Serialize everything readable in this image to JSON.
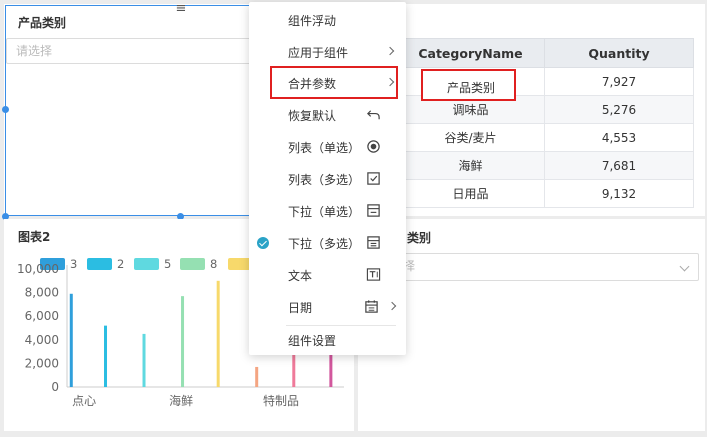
{
  "filter_panel": {
    "title": "产品类别",
    "placeholder": "请选择"
  },
  "table": {
    "columns": [
      "CategoryName",
      "Quantity"
    ],
    "rows": [
      [
        "",
        "7,927"
      ],
      [
        "调味品",
        "5,276"
      ],
      [
        "谷类/麦片",
        "4,553"
      ],
      [
        "海鲜",
        "7,681"
      ],
      [
        "日用品",
        "9,132"
      ]
    ]
  },
  "tooltip": {
    "text": "产品类别"
  },
  "chart": {
    "title": "图表2",
    "legend": [
      {
        "label": "3",
        "color": "#2f9fdb"
      },
      {
        "label": "2",
        "color": "#2bbde2"
      },
      {
        "label": "5",
        "color": "#5fd9e0"
      },
      {
        "label": "8",
        "color": "#95e0b2"
      },
      {
        "label": "",
        "color": "#f7d96b"
      }
    ]
  },
  "chart_data": {
    "type": "bar",
    "title": "图表2",
    "categories": [
      "点心",
      "海鲜",
      "特制品"
    ],
    "ylim": [
      0,
      10000
    ],
    "yticks": [
      "0",
      "2,000",
      "4,000",
      "6,000",
      "8,000",
      "10,000"
    ],
    "grid": false,
    "legend_position": "top-left",
    "series": [
      {
        "name": "3",
        "color": "#2f9fdb"
      },
      {
        "name": "2",
        "color": "#2bbde2"
      },
      {
        "name": "5",
        "color": "#5fd9e0"
      },
      {
        "name": "8",
        "color": "#95e0b2"
      },
      {
        "name": "",
        "color": "#f7d96b"
      },
      {
        "name": "",
        "color": "#f4a582"
      },
      {
        "name": "",
        "color": "#ef7a9a"
      },
      {
        "name": "",
        "color": "#d2579d"
      }
    ],
    "bars": [
      {
        "x": 0.3,
        "value": 7900,
        "series": 0
      },
      {
        "x": 2.7,
        "value": 5200,
        "series": 1
      },
      {
        "x": 5.4,
        "value": 4500,
        "series": 2
      },
      {
        "x": 8.1,
        "value": 7700,
        "series": 3
      },
      {
        "x": 10.6,
        "value": 9000,
        "series": 4
      },
      {
        "x": 13.3,
        "value": 1700,
        "series": 5
      },
      {
        "x": 15.9,
        "value": 7600,
        "series": 6
      },
      {
        "x": 18.5,
        "value": 5500,
        "series": 7
      }
    ],
    "x_ticks": [
      {
        "label": "点心",
        "x": 1.2
      },
      {
        "label": "海鲜",
        "x": 8.0
      },
      {
        "label": "特制品",
        "x": 15.0
      }
    ],
    "x_range": [
      0,
      19
    ]
  },
  "filter_panel2": {
    "title": "类别",
    "placeholder": "择"
  },
  "context_menu": {
    "items": [
      {
        "label": "组件浮动",
        "icon": "",
        "submenu": false,
        "checked": false
      },
      {
        "label": "应用于组件",
        "icon": "",
        "submenu": true,
        "checked": false
      },
      {
        "label": "合并参数",
        "icon": "",
        "submenu": true,
        "checked": false
      },
      {
        "label": "恢复默认",
        "icon": "undo-icon",
        "submenu": false,
        "checked": false
      },
      {
        "label": "列表（单选）",
        "icon": "radio-icon",
        "submenu": false,
        "checked": false
      },
      {
        "label": "列表（多选）",
        "icon": "checkbox-icon",
        "submenu": false,
        "checked": false
      },
      {
        "label": "下拉（单选）",
        "icon": "dropdown-single-icon",
        "submenu": false,
        "checked": false
      },
      {
        "label": "下拉（多选）",
        "icon": "dropdown-multi-icon",
        "submenu": false,
        "checked": true
      },
      {
        "label": "文本",
        "icon": "text-icon",
        "submenu": false,
        "checked": false
      },
      {
        "label": "日期",
        "icon": "calendar-icon",
        "submenu": true,
        "checked": false
      },
      {
        "label": "组件设置",
        "icon": "",
        "submenu": false,
        "checked": false
      }
    ]
  },
  "colors": {
    "selection": "#3a8ee6",
    "highlight_border": "#e02020",
    "check": "#2aa3c7"
  }
}
